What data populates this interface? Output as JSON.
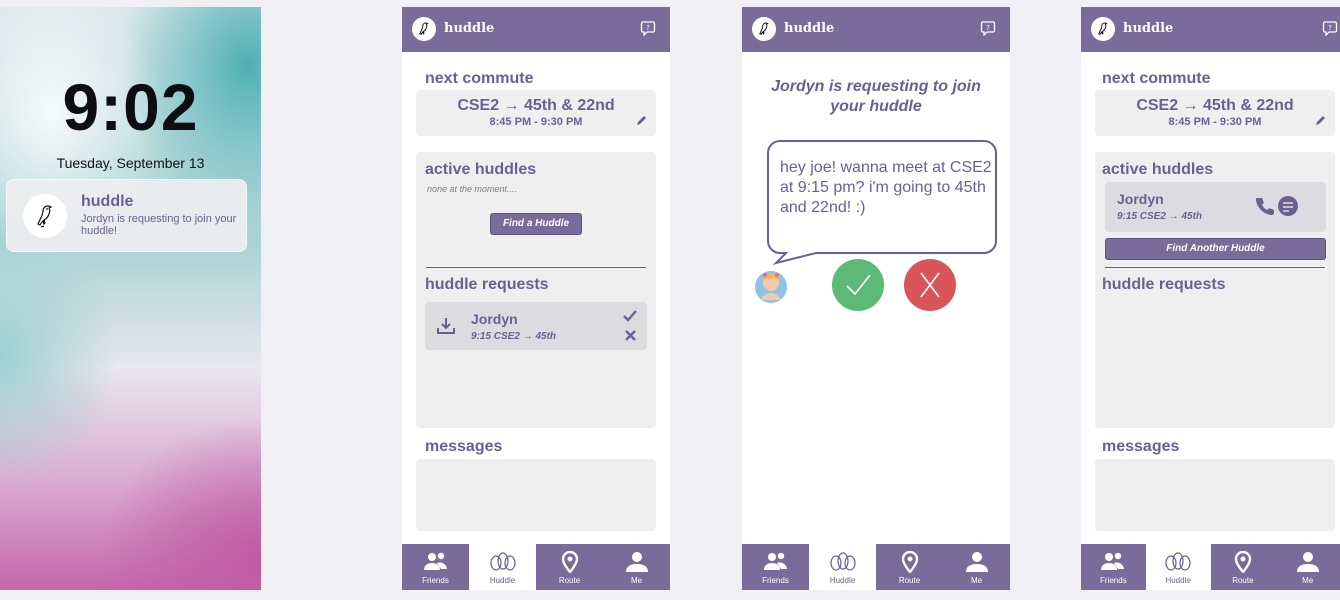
{
  "lock_screen": {
    "time": "9:02",
    "date": "Tuesday, September 13",
    "notification": {
      "app": "huddle",
      "body": "Jordyn is requesting to join your huddle!"
    }
  },
  "app": {
    "name": "huddle",
    "accent": "#7a6c9a"
  },
  "home": {
    "next_commute_title": "next commute",
    "commute_route": "CSE2 → 45th & 22nd",
    "commute_time": "8:45 PM - 9:30 PM",
    "active_huddles_title": "active huddles",
    "none_text": "none at the moment....",
    "find_button": "Find a Huddle",
    "requests_title": "huddle requests",
    "request": {
      "name": "Jordyn",
      "meta": "9:15  CSE2 → 45th"
    },
    "messages_title": "messages"
  },
  "request_screen": {
    "title_line1": "Jordyn is requesting to join",
    "title_line2": "your huddle",
    "message": "hey joe! wanna meet at CSE2 at 9:15 pm? i'm going to 45th and 22nd! :)",
    "accept_color": "#5cba76",
    "decline_color": "#d95559"
  },
  "home_after": {
    "next_commute_title": "next commute",
    "commute_route": "CSE2 → 45th & 22nd",
    "commute_time": "8:45 PM - 9:30 PM",
    "active_huddles_title": "active huddles",
    "huddle": {
      "name": "Jordyn",
      "meta": "9:15  CSE2 → 45th"
    },
    "find_another_button": "Find Another Huddle",
    "requests_title": "huddle requests",
    "messages_title": "messages"
  },
  "nav": {
    "friends": "Friends",
    "huddle": "Huddle",
    "route": "Route",
    "me": "Me"
  }
}
